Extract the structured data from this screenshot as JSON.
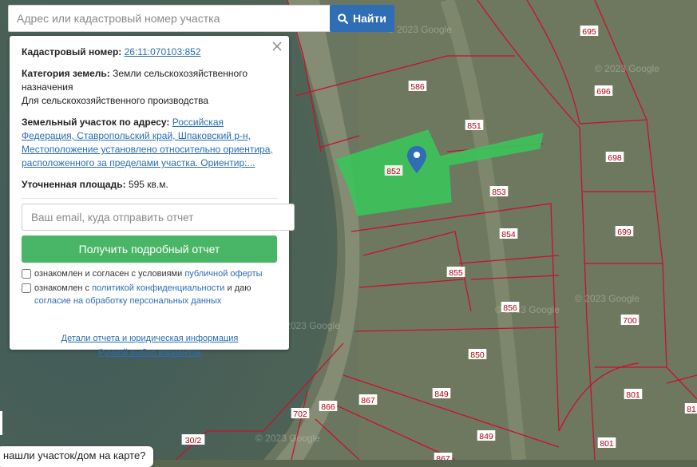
{
  "search": {
    "placeholder": "Адрес или кадастровый номер участка",
    "button_label": "Найти"
  },
  "panel": {
    "cadastral_label": "Кадастровый номер:",
    "cadastral_number": "26:11:070103:852",
    "category_label": "Категория земель:",
    "category_value": "Земли сельскохозяйственного назначения",
    "usage_value": "Для сельскохозяйственного производства",
    "address_label": "Земельный участок по адресу:",
    "address_value": "Российская Федерация, Ставропольский край, Шпаковский р-н, Местоположение установлено относительно ориентира, расположенного за пределами участка. Ориентир:...",
    "area_label": "Уточненная площадь:",
    "area_value": "595 кв.м.",
    "email_placeholder": "Ваш email, куда отправить отчет",
    "report_button": "Получить подробный отчет",
    "consent1_text": "ознакомлен и согласен с условиями",
    "consent1_link": "публичной оферты",
    "consent2_text": "ознакомлен с",
    "consent2_link": "политикой конфиденциальности",
    "consent2_mid": "и даю",
    "consent2_link2": "согласие на обработку персональных данных",
    "details_link": "Детали отчета и юридическая информация",
    "manual_link": "Ручной выбор вариантов"
  },
  "bottom_bubble": "нашли участок/дом на карте?",
  "map": {
    "watermark": "© 2023 Google",
    "parcel_labels": [
      "695",
      "586",
      "696",
      "851",
      "698",
      "852",
      "853",
      "854",
      "699",
      "855",
      "856",
      "700",
      "850",
      "849",
      "801",
      "867",
      "866",
      "702",
      "30/2",
      "849",
      "801",
      "867",
      "81"
    ],
    "selected_color": "#3cc35a",
    "boundary_color": "#c8102e",
    "icons": [
      "map-pin-icon",
      "search-icon",
      "close-icon"
    ]
  }
}
